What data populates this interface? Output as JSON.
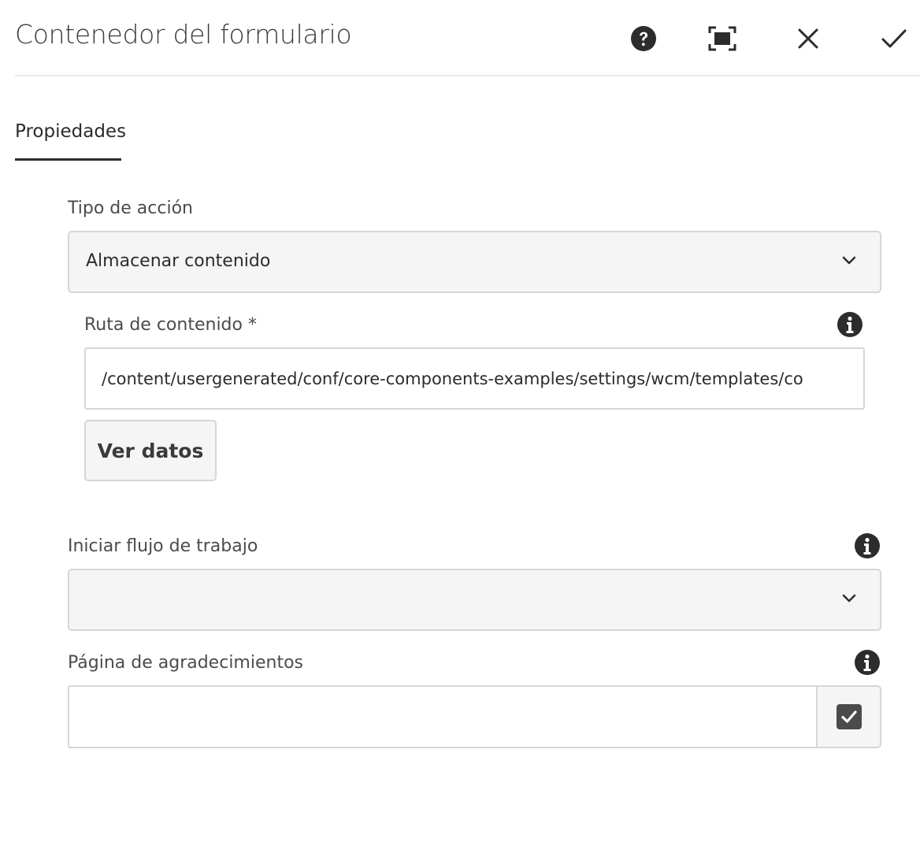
{
  "dialog": {
    "title": "Contenedor del formulario",
    "toolbar": {
      "help_icon": "help-icon",
      "fullscreen_icon": "fullscreen-icon",
      "close_icon": "close-icon",
      "done_icon": "checkmark-icon"
    }
  },
  "tabs": [
    {
      "label": "Propiedades",
      "selected": true
    }
  ],
  "form": {
    "action_type": {
      "label": "Tipo de acción",
      "selected_value": "Almacenar contenido"
    },
    "content_path": {
      "label": "Ruta de contenido *",
      "value": "/content/usergenerated/conf/core-components-examples/settings/wcm/templates/co"
    },
    "view_data_button": {
      "label": "Ver datos"
    },
    "workflow": {
      "label": "Iniciar flujo de trabajo",
      "selected_value": ""
    },
    "thank_you_page": {
      "label": "Página de agradecimientos",
      "value": ""
    }
  },
  "colors": {
    "text": "#2c2c2c",
    "label": "#4b4b4b",
    "border": "#d6d6d6",
    "field_bg": "#f5f5f5",
    "icon": "#2c2c2c"
  }
}
